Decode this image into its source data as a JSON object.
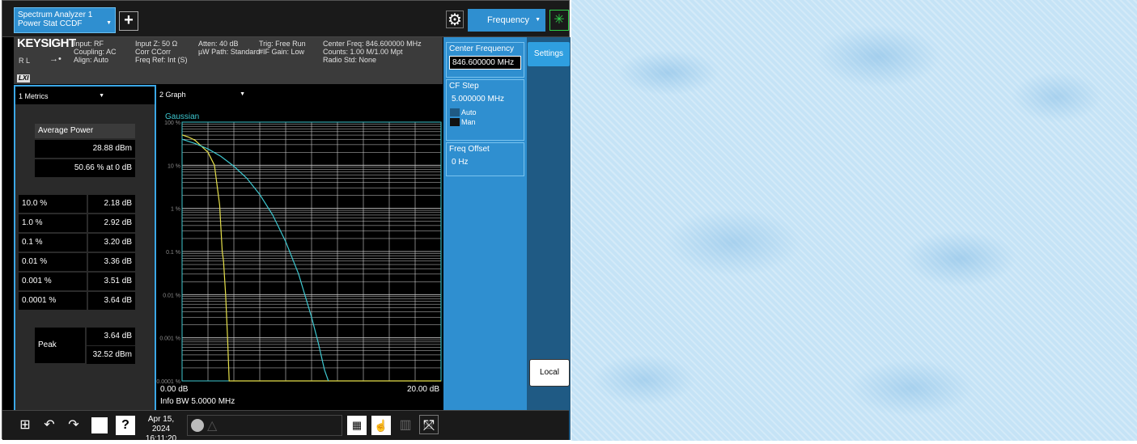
{
  "header": {
    "mode_line1": "Spectrum Analyzer 1",
    "mode_line2": "Power Stat CCDF",
    "add_icon": "+",
    "gear_icon": "gear-icon",
    "menu": "Frequency",
    "busy_icon": "busy-spinner-icon"
  },
  "info": {
    "brand": "KEYSIGHT",
    "rl": "R L",
    "lxi": "LXI",
    "col1": [
      "Input: RF",
      "Coupling: AC",
      "Align: Auto"
    ],
    "col2": [
      "Input Z: 50 Ω",
      "Corr CCorr",
      "Freq Ref: Int (S)"
    ],
    "col3": [
      "Atten: 40 dB",
      "µW Path: Standard"
    ],
    "col4": [
      "Trig: Free Run",
      "#IF Gain: Low"
    ],
    "col5": [
      "Center Freq: 846.600000 MHz",
      "Counts: 1.00 M/1.00 Mpt",
      "Radio Std: None"
    ]
  },
  "panel": {
    "center_freq_label": "Center Frequency",
    "center_freq_value": "846.600000 MHz",
    "cf_step_label": "CF Step",
    "cf_step_value": "5.000000 MHz",
    "auto_label": "Auto",
    "man_label": "Man",
    "freq_offset_label": "Freq Offset",
    "freq_offset_value": "0 Hz",
    "settings_tab": "Settings",
    "local_button": "Local"
  },
  "metrics": {
    "pane_title": "1 Metrics",
    "avg_power_label": "Average Power",
    "avg_power_value": "28.88 dBm",
    "avg_power_pct": "50.66 % at 0 dB",
    "rows": [
      {
        "pct": "10.0 %",
        "val": "2.18 dB"
      },
      {
        "pct": "1.0 %",
        "val": "2.92 dB"
      },
      {
        "pct": "0.1 %",
        "val": "3.20 dB"
      },
      {
        "pct": "0.01 %",
        "val": "3.36 dB"
      },
      {
        "pct": "0.001 %",
        "val": "3.51 dB"
      },
      {
        "pct": "0.0001 %",
        "val": "3.64 dB"
      }
    ],
    "peak_label": "Peak",
    "peak_db": "3.64 dB",
    "peak_dbm": "32.52 dBm"
  },
  "graph": {
    "pane_title": "2 Graph",
    "legend_gaussian": "Gaussian",
    "x_start": "0.00 dB",
    "x_end": "20.00 dB",
    "info_bw": "Info BW 5.0000 MHz",
    "colors": {
      "measured": "#e6e04a",
      "gaussian": "#3ec8d0",
      "grid": "#d0d0d0"
    }
  },
  "chart_data": {
    "type": "line",
    "title": "",
    "xlabel": "",
    "ylabel": "",
    "xlim": [
      0,
      20
    ],
    "ylim_log": [
      0.0001,
      100
    ],
    "y_scale": "log",
    "y_ticks": [
      "100 %",
      "10 %",
      "1 %",
      "0.1 %",
      "0.01 %",
      "0.001 %",
      "0.0001 %"
    ],
    "series": [
      {
        "name": "",
        "x": [
          0,
          0.5,
          1,
          2,
          2.5,
          2.9,
          3.1,
          3.2,
          3.36,
          3.51,
          3.64,
          3.64,
          20
        ],
        "y": [
          50.66,
          45,
          38,
          20,
          10,
          1.2,
          0.1,
          0.06,
          0.01,
          0.001,
          0.0001,
          0.0001,
          0.0001
        ]
      },
      {
        "name": "Gaussian",
        "x": [
          0,
          1,
          2,
          3,
          4,
          5,
          6,
          7,
          8,
          9,
          10,
          10.5,
          11,
          11.3
        ],
        "y": [
          40,
          32,
          24,
          16,
          9.5,
          5,
          2.1,
          0.7,
          0.17,
          0.03,
          0.003,
          0.0008,
          0.00018,
          0.0001
        ]
      }
    ]
  },
  "toolbar": {
    "date": "Apr 15, 2024",
    "time": "16:11:20",
    "icons": [
      "windows-icon",
      "undo-icon",
      "redo-icon",
      "file-icon",
      "help-icon",
      "message-icon",
      "tile-grid-icon",
      "touch-icon",
      "layout-icon",
      "fullscreen-icon"
    ]
  }
}
